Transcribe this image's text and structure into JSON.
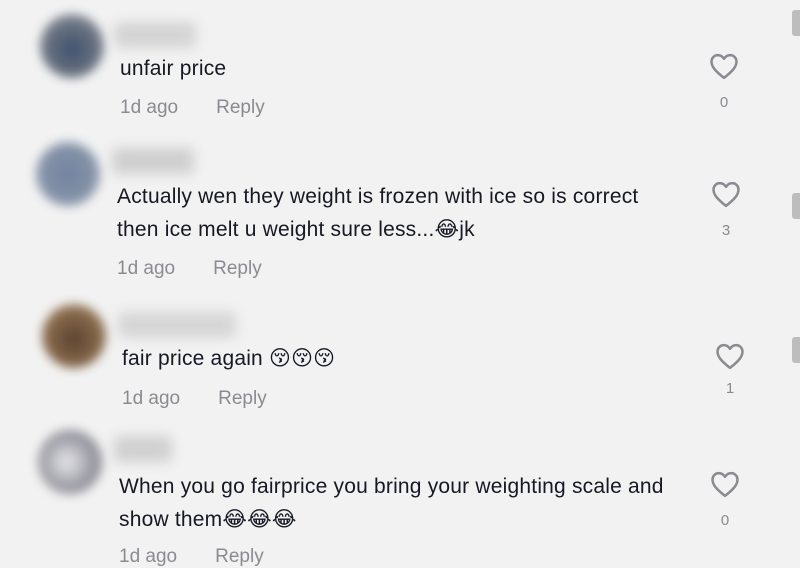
{
  "colors": {
    "background": "#f2f2f2",
    "text": "#161823",
    "secondary": "#8a8b91"
  },
  "comments": [
    {
      "text": "unfair price",
      "time": "1d ago",
      "reply_label": "Reply",
      "likes": "0",
      "avatar_color": "#6a7380",
      "username_color": "#d4d4d4"
    },
    {
      "text": "Actually wen they weight is frozen with ice so is correct then ice melt u weight sure less...😂jk",
      "time": "1d ago",
      "reply_label": "Reply",
      "likes": "3",
      "avatar_color": "#8593a8",
      "username_color": "#cfcfcf"
    },
    {
      "text": "fair price again 😚😚😚",
      "time": "1d ago",
      "reply_label": "Reply",
      "likes": "1",
      "avatar_color": "#8a6c4e",
      "username_color": "#d6d6d6"
    },
    {
      "text": "When you go fairprice you bring your weighting scale and show them😂😂😂",
      "time": "1d ago",
      "reply_label": "Reply",
      "likes": "0",
      "avatar_color": "#9a9aa3",
      "username_color": "#d0d0d0"
    }
  ]
}
